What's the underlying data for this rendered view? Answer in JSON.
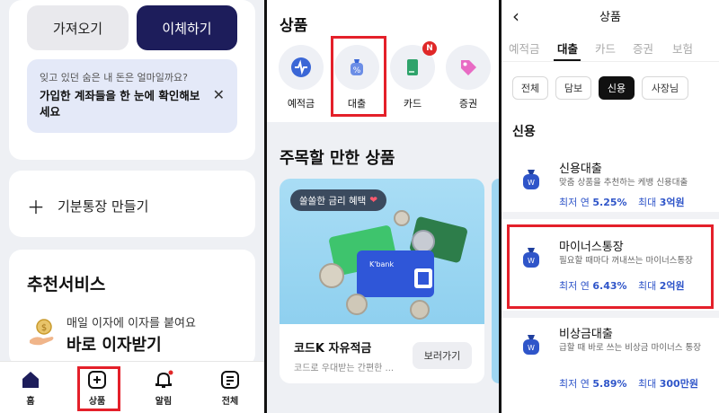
{
  "panel1": {
    "import_button": "가져오기",
    "transfer_button": "이체하기",
    "notice": {
      "sub": "잊고 있던 숨은 내 돈은 얼마일까요?",
      "main": "가입한 계좌들을 한 눈에 확인해보세요"
    },
    "create_account": "기분통장 만들기",
    "recommend_title": "추천서비스",
    "recommend_sub": "매일 이자에 이자를 붙여요",
    "recommend_main": "바로 이자받기",
    "tabs": [
      "홈",
      "상품",
      "알림",
      "전체"
    ]
  },
  "panel2": {
    "title": "상품",
    "categories": [
      "예적금",
      "대출",
      "카드",
      "증권"
    ],
    "card_badge": "N",
    "section_title": "주목할 만한 상품",
    "promo": {
      "pill": "쏠쏠한 금리 혜택",
      "card_brand": "K'bank",
      "name": "코드K 자유적금",
      "desc": "코드로 우대받는 간편한 ...",
      "button": "보러가기"
    }
  },
  "panel3": {
    "title": "상품",
    "tabs": [
      "예적금",
      "대출",
      "카드",
      "증권",
      "보험"
    ],
    "chips": [
      "전체",
      "담보",
      "신용",
      "사장님"
    ],
    "section": "신용",
    "products": [
      {
        "name": "신용대출",
        "desc": "맞춤 상품을 추천하는 케뱅 신용대출",
        "rate_label": "최저 연",
        "rate": "5.25%",
        "max_label": "최대",
        "max": "3억원"
      },
      {
        "name": "마이너스통장",
        "desc": "필요할 때마다 꺼내쓰는 마이너스통장",
        "rate_label": "최저 연",
        "rate": "6.43%",
        "max_label": "최대",
        "max": "2억원"
      },
      {
        "name": "비상금대출",
        "desc": "급할 때 바로 쓰는 비상금 마이너스 통장",
        "rate_label": "최저 연",
        "rate": "5.89%",
        "max_label": "최대",
        "max": "300만원"
      }
    ]
  },
  "colors": {
    "navy": "#1d1d5b",
    "highlight_red": "#e4202a",
    "rate_blue": "#2f55c9",
    "notice_bg": "#e4e9f8"
  }
}
